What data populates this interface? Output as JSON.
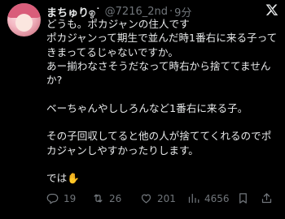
{
  "tweet": {
    "author": {
      "display_name": "まちゅり",
      "name_emoji": "ඉ˙",
      "handle": "@7216_2nd",
      "separator": "·",
      "time": "9分"
    },
    "body_lines": [
      "どうも。ポカジャンの住人です",
      "ポカジャンって期生で並んだ時1番右に来る子って",
      "きまってるじゃないですか。",
      "あー揃わなさそうだなって時右から捨ててません",
      "か?",
      "ベーちゃんやししろんなど1番右に来る子。",
      "その子回収してると他の人が捨ててくれるのでポ",
      "カジャンしやすかったりします。",
      "では✋"
    ],
    "stats": {
      "replies": "19",
      "retweets": "26",
      "likes": "201",
      "views": "4656"
    }
  },
  "icons": {
    "brand": "x-logo-icon",
    "reply": "reply-icon",
    "retweet": "retweet-icon",
    "like": "heart-icon",
    "views": "views-icon",
    "bookmark": "bookmark-icon",
    "share": "share-icon"
  },
  "colors": {
    "background": "#000000",
    "text": "#e7e9ea",
    "muted": "#71767b"
  }
}
